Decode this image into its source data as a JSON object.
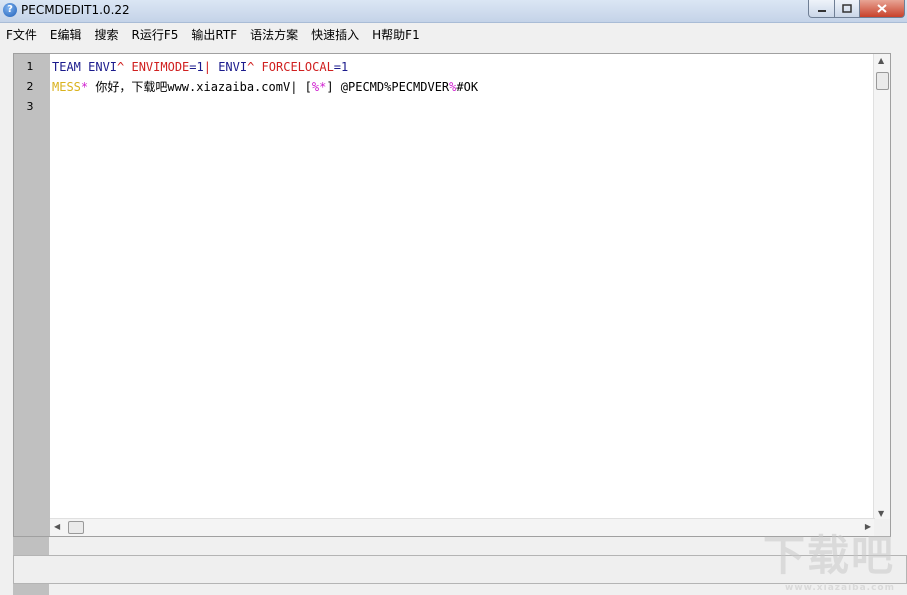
{
  "window": {
    "title": "PECMDEDIT1.0.22",
    "icon_glyph": "?"
  },
  "menu": [
    {
      "label": "F文件"
    },
    {
      "label": "E编辑"
    },
    {
      "label": "搜索"
    },
    {
      "label": "R运行F5"
    },
    {
      "label": "输出RTF"
    },
    {
      "label": "语法方案"
    },
    {
      "label": "快速插入"
    },
    {
      "label": "H帮助F1"
    }
  ],
  "editor": {
    "line_numbers": [
      "1",
      "2",
      "3"
    ],
    "lines": [
      [
        {
          "text": "TEAM ENVI",
          "color": "#1a1a8c"
        },
        {
          "text": "^ ",
          "color": "#d02020"
        },
        {
          "text": "ENVIMODE",
          "color": "#d02020"
        },
        {
          "text": "=1",
          "color": "#1a1a8c"
        },
        {
          "text": "| ",
          "color": "#d02020"
        },
        {
          "text": "ENVI",
          "color": "#1a1a8c"
        },
        {
          "text": "^ ",
          "color": "#d02020"
        },
        {
          "text": "FORCELOCAL",
          "color": "#d02020"
        },
        {
          "text": "=1",
          "color": "#1a1a8c"
        }
      ],
      [
        {
          "text": "MESS",
          "color": "#d9b21c"
        },
        {
          "text": "* ",
          "color": "#d020d0"
        },
        {
          "text": "你好，下载吧www.xiazaiba.comV",
          "color": "#000000"
        },
        {
          "text": "| ",
          "color": "#000000"
        },
        {
          "text": "[",
          "color": "#000000"
        },
        {
          "text": "%*",
          "color": "#d020d0"
        },
        {
          "text": "] @PECMD%PECMDVER",
          "color": "#000000"
        },
        {
          "text": "%",
          "color": "#d020d0"
        },
        {
          "text": "#OK",
          "color": "#000000"
        }
      ],
      []
    ]
  },
  "watermark": {
    "text": "下载吧",
    "sub": "www.xiazaiba.com"
  }
}
